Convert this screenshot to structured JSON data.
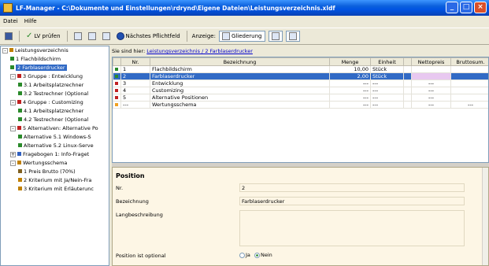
{
  "window": {
    "title": "LF-Manager - C:\\Dokumente und Einstellungen\\rdrynd\\Eigene Dateien\\Leistungsverzeichnis.xldf"
  },
  "menu": [
    "Datei",
    "Hilfe"
  ],
  "toolbar": {
    "lv_pruefen": "LV prüfen",
    "next_required": "Nächstes Pflichtfeld",
    "anzeige_label": "Anzeige:",
    "gliederung": "Gliederung"
  },
  "tree": [
    {
      "label": "Leistungsverzeichnis",
      "indent": 0,
      "exp": "-",
      "color": "#c08000"
    },
    {
      "label": "1 Flachbildschirm",
      "indent": 1,
      "color": "#2a8a2a"
    },
    {
      "label": "2 Farblaserdrucker",
      "indent": 1,
      "color": "#2a8a2a",
      "selected": true
    },
    {
      "label": "3 Gruppe : Entwicklung",
      "indent": 1,
      "exp": "-",
      "color": "#c02020"
    },
    {
      "label": "3.1 Arbeitsplatzrechner",
      "indent": 2,
      "color": "#2a8a2a"
    },
    {
      "label": "3.2 Testrechner (Optional",
      "indent": 2,
      "color": "#2a8a2a"
    },
    {
      "label": "4 Gruppe : Customizing",
      "indent": 1,
      "exp": "-",
      "color": "#c02020"
    },
    {
      "label": "4.1 Arbeitsplatzrechner",
      "indent": 2,
      "color": "#2a8a2a"
    },
    {
      "label": "4.2 Testrechner (Optional",
      "indent": 2,
      "color": "#2a8a2a"
    },
    {
      "label": "5 Alternativen: Alternative Po",
      "indent": 1,
      "exp": "-",
      "color": "#c02020"
    },
    {
      "label": "Alternative 5.1 Windows-S",
      "indent": 2,
      "color": "#2a8a2a"
    },
    {
      "label": "Alternative 5.2 Linux-Serve",
      "indent": 2,
      "color": "#2a8a2a"
    },
    {
      "label": "Fragebogen 1: Info-Fraget",
      "indent": 1,
      "exp": "+",
      "color": "#3060c0"
    },
    {
      "label": "Wertungsschema",
      "indent": 1,
      "exp": "-",
      "color": "#c08000"
    },
    {
      "label": "1 Preis Brutto  (70%)",
      "indent": 2,
      "color": "#806020"
    },
    {
      "label": "2 Kriterium mit Ja/Nein-Fra",
      "indent": 2,
      "color": "#c08000"
    },
    {
      "label": "3 Kriterium mit Erläuterunc",
      "indent": 2,
      "color": "#c08000"
    }
  ],
  "breadcrumb": {
    "prefix": "Sie sind hier:",
    "path": "Leistungsverzeichnis / 2 Farblaserdrucker"
  },
  "grid": {
    "columns": [
      "Nr.",
      "Bezeichnung",
      "Menge",
      "Einheit",
      "Nettopreis",
      "Bruttosum."
    ],
    "rows": [
      {
        "nr": "1",
        "bez": "Flachbildschirm",
        "menge": "10,00",
        "einheit": "Stück",
        "netto": "",
        "brutto": "",
        "mark": "#2a8a2a"
      },
      {
        "nr": "2",
        "bez": "Farblaserdrucker",
        "menge": "2,00",
        "einheit": "Stück",
        "netto": "",
        "brutto": "",
        "mark": "#2a8a2a",
        "selected": true
      },
      {
        "nr": "3",
        "bez": "Entwicklung",
        "menge": "---",
        "einheit": "---",
        "netto": "---",
        "brutto": "",
        "mark": "#c02020"
      },
      {
        "nr": "4",
        "bez": "Customizing",
        "menge": "---",
        "einheit": "---",
        "netto": "---",
        "brutto": "",
        "mark": "#c02020"
      },
      {
        "nr": "5",
        "bez": "Alternative Positionen",
        "menge": "---",
        "einheit": "---",
        "netto": "---",
        "brutto": "",
        "mark": "#c02020"
      },
      {
        "nr": "---",
        "bez": "Wertungsschema",
        "menge": "---",
        "einheit": "---",
        "netto": "---",
        "brutto": "---",
        "mark": "#f0a020"
      }
    ]
  },
  "detail": {
    "heading": "Position",
    "nr_label": "Nr.",
    "nr_value": "2",
    "bez_label": "Bezeichnung",
    "bez_value": "Farblaserdrucker",
    "lang_label": "Langbeschreibung",
    "optional_label": "Position ist optional",
    "ja": "Ja",
    "nein": "Nein"
  }
}
